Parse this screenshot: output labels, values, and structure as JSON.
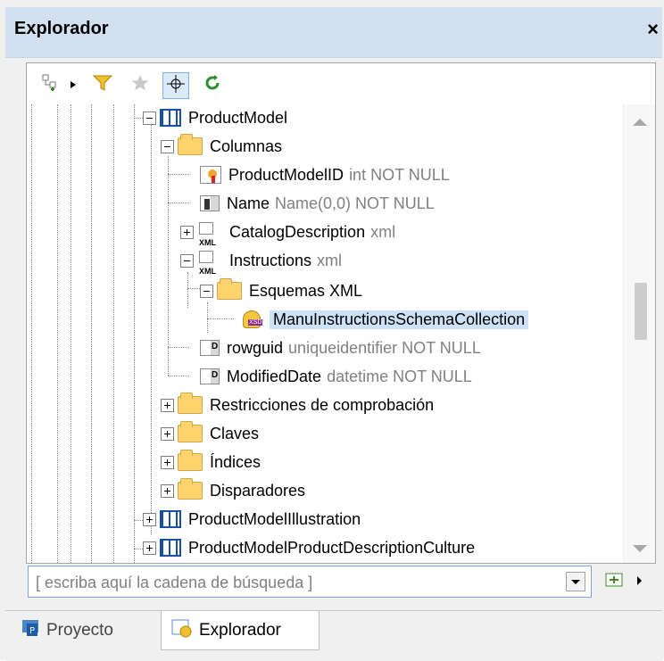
{
  "window": {
    "title": "Explorador",
    "close_label": "×"
  },
  "toolbar": {
    "add_icon": "add-node-icon",
    "filter_icon": "filter-icon",
    "star_icon": "favorite-icon",
    "locate_icon": "locate-icon",
    "refresh_icon": "refresh-icon"
  },
  "tree": {
    "rows": [
      {
        "name": "ProductModel"
      },
      {
        "name": "Columnas"
      },
      {
        "name": "ProductModelID",
        "type": "int NOT NULL"
      },
      {
        "name": "Name",
        "type": "Name(0,0) NOT NULL"
      },
      {
        "name": "CatalogDescription",
        "type": "xml"
      },
      {
        "name": "Instructions",
        "type": "xml"
      },
      {
        "name": "Esquemas XML"
      },
      {
        "name": "ManuInstructionsSchemaCollection"
      },
      {
        "name": "rowguid",
        "type": "uniqueidentifier NOT NULL"
      },
      {
        "name": "ModifiedDate",
        "type": "datetime NOT NULL"
      },
      {
        "name": "Restricciones de comprobación"
      },
      {
        "name": "Claves"
      },
      {
        "name": "Índices"
      },
      {
        "name": "Disparadores"
      },
      {
        "name": "ProductModelIllustration"
      },
      {
        "name": "ProductModelProductDescriptionCulture"
      }
    ]
  },
  "search": {
    "placeholder": "[ escriba aquí la cadena de búsqueda ]"
  },
  "tabs": {
    "project": "Proyecto",
    "explorer": "Explorador"
  },
  "colors": {
    "titlebar": "#d3e0f0",
    "selection": "#cde1f7",
    "type_text": "#808080"
  }
}
